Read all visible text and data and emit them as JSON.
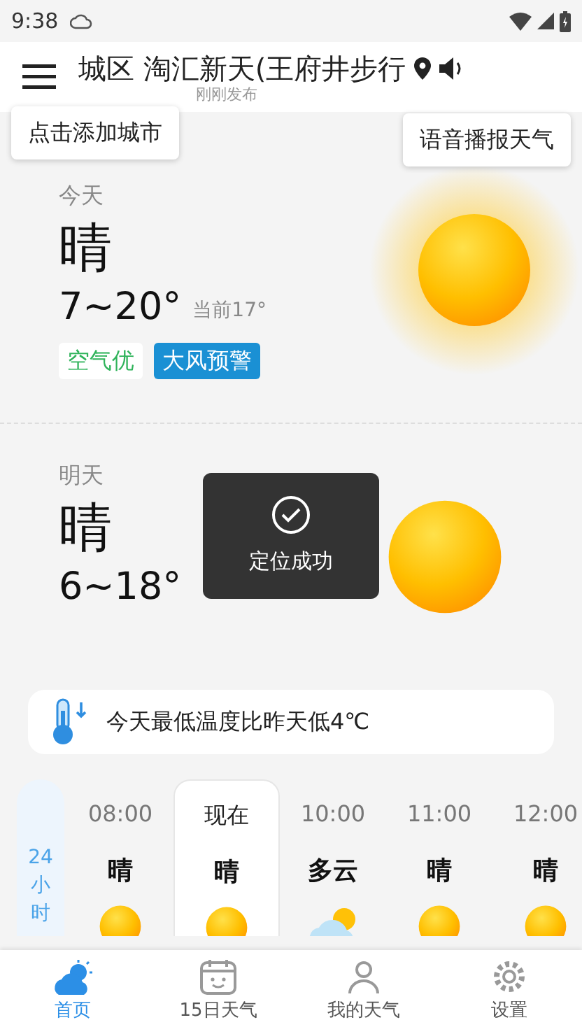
{
  "status_bar": {
    "time": "9:38"
  },
  "header": {
    "location": "城区 淘汇新天(王府井步行",
    "updated": "刚刚发布"
  },
  "tooltips": [
    "点击添加城市",
    "语音播报天气"
  ],
  "today": {
    "label": "今天",
    "condition": "晴",
    "range": "7~20°",
    "current": "当前17°",
    "tags": [
      {
        "text": "空气优",
        "kind": "air"
      },
      {
        "text": "大风预警",
        "kind": "warning"
      }
    ]
  },
  "tomorrow": {
    "label": "明天",
    "condition": "晴",
    "range": "6~18°"
  },
  "toast": {
    "text": "定位成功"
  },
  "notice": "今天最低温度比昨天低4℃",
  "hourly": {
    "label": "24小时",
    "items": [
      {
        "time": "08:00",
        "condition": "晴",
        "kind": "sunny",
        "selected": false
      },
      {
        "time": "现在",
        "condition": "晴",
        "kind": "sunny",
        "selected": true
      },
      {
        "time": "10:00",
        "condition": "多云",
        "kind": "cloudy",
        "selected": false
      },
      {
        "time": "11:00",
        "condition": "晴",
        "kind": "sunny",
        "selected": false
      },
      {
        "time": "12:00",
        "condition": "晴",
        "kind": "sunny",
        "selected": false
      }
    ]
  },
  "nav": [
    {
      "label": "首页",
      "selected": true
    },
    {
      "label": "15日天气",
      "selected": false
    },
    {
      "label": "我的天气",
      "selected": false
    },
    {
      "label": "设置",
      "selected": false
    }
  ]
}
